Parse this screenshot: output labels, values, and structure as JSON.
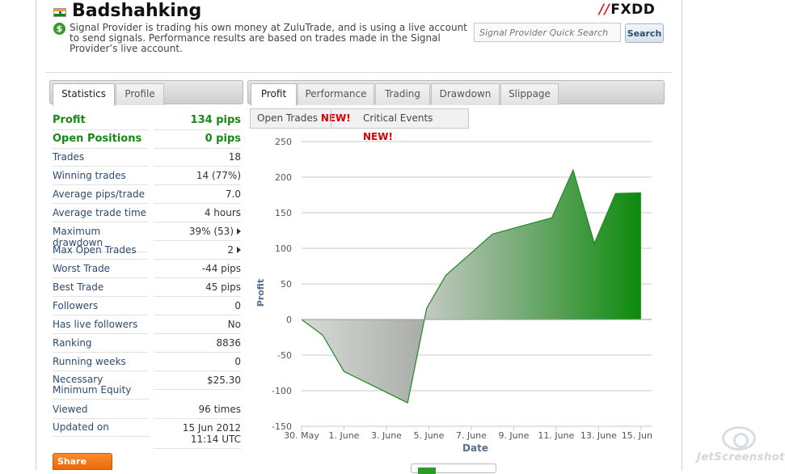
{
  "header": {
    "provider_name": "Badshahking",
    "description": "Signal Provider is trading his own money at ZuluTrade, and is using a live account to send signals. Performance results are based on trades made in the Signal Provider’s live account.",
    "broker_logo": "FXDD",
    "search_placeholder": "Signal Provider Quick Search",
    "search_button": "Search",
    "flag_icon": "india-flag-icon"
  },
  "left_tabs": [
    "Statistics",
    "Profile"
  ],
  "right_tabs": [
    "Profit",
    "Performance",
    "Trading",
    "Drawdown",
    "Slippage"
  ],
  "subtabs": [
    {
      "label": "Open Trades",
      "badge": "NEW!"
    },
    {
      "label": "Critical Events",
      "badge": "NEW!"
    }
  ],
  "stats": [
    {
      "label": "Profit",
      "value": "134 pips",
      "highlight": true
    },
    {
      "label": "Open Positions",
      "value": "0 pips",
      "highlight": true
    },
    {
      "label": "Trades",
      "value": "18"
    },
    {
      "label": "Winning trades",
      "value": "14 (77%)"
    },
    {
      "label": "Average pips/trade",
      "value": "7.0"
    },
    {
      "label": "Average trade time",
      "value": "4 hours"
    },
    {
      "label": "Maximum drawdown",
      "value": "39% (53)",
      "arrow": true
    },
    {
      "label": "Max Open Trades",
      "value": "2",
      "arrow": true
    },
    {
      "label": "Worst Trade",
      "value": "-44 pips"
    },
    {
      "label": "Best Trade",
      "value": "45 pips"
    },
    {
      "label": "Followers",
      "value": "0"
    },
    {
      "label": "Has live followers",
      "value": "No"
    },
    {
      "label": "Ranking",
      "value": "8836"
    },
    {
      "label": "Running weeks",
      "value": "0"
    },
    {
      "label": "Necessary Minimum Equity",
      "value": "$25.30",
      "tall": true
    },
    {
      "label": "Viewed",
      "value": "96 times"
    },
    {
      "label": "Updated on",
      "value": "15 Jun 2012 11:14 UTC",
      "tall": true
    }
  ],
  "share_button": "Share",
  "watermark": "JetScreenshot",
  "colors": {
    "profit_green": "#168a16",
    "area_green": "#118a11",
    "area_grey": "#b0b0b0",
    "new_badge": "#d40000",
    "label_blue": "#2c4a72"
  },
  "chart_data": {
    "type": "area",
    "xlabel": "Date",
    "ylabel": "Profit",
    "ylim": [
      -150,
      250
    ],
    "yticks": [
      -150,
      -100,
      -50,
      0,
      50,
      100,
      150,
      200,
      250
    ],
    "xtick_labels": [
      "30. May",
      "1. June",
      "3. June",
      "5. June",
      "7. June",
      "9. June",
      "11. June",
      "13. June",
      "15. Jun"
    ],
    "xlim_days": [
      0,
      16.5
    ],
    "points": [
      {
        "day": 0.0,
        "y": 0
      },
      {
        "day": 1.0,
        "y": -22
      },
      {
        "day": 2.0,
        "y": -73
      },
      {
        "day": 5.0,
        "y": -117
      },
      {
        "day": 5.9,
        "y": 16
      },
      {
        "day": 6.8,
        "y": 62
      },
      {
        "day": 9.0,
        "y": 120
      },
      {
        "day": 11.8,
        "y": 143
      },
      {
        "day": 12.8,
        "y": 210
      },
      {
        "day": 13.8,
        "y": 107
      },
      {
        "day": 14.8,
        "y": 177
      },
      {
        "day": 16.0,
        "y": 178
      }
    ]
  }
}
